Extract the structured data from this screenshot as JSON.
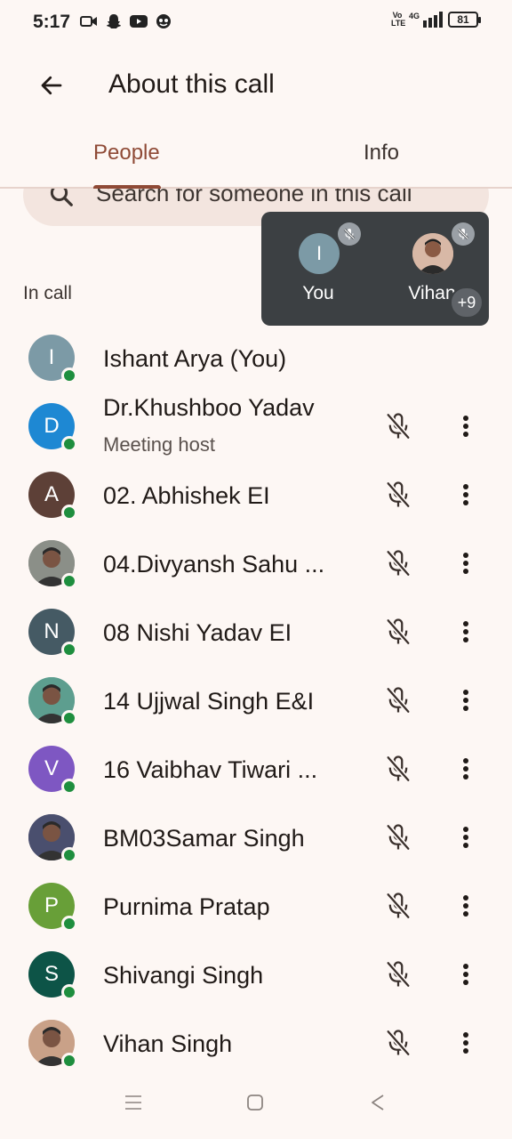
{
  "status_bar": {
    "time": "5:17",
    "left_icons": [
      "video-icon",
      "snapchat-icon",
      "youtube-icon",
      "app-icon"
    ],
    "volte": "Vo LTE",
    "network": "4G",
    "battery": "81"
  },
  "header": {
    "title": "About this call"
  },
  "tabs": [
    {
      "label": "People",
      "active": true
    },
    {
      "label": "Info",
      "active": false
    }
  ],
  "search": {
    "placeholder": "Search for someone in this call"
  },
  "section": {
    "label": "In call"
  },
  "overlay": {
    "tiles": [
      {
        "initial": "I",
        "name": "You"
      },
      {
        "initial": "",
        "name": "Vihan"
      }
    ],
    "more": "+9"
  },
  "participants": [
    {
      "name": "Ishant Arya (You)",
      "subtitle": "",
      "initial": "I",
      "color": "#7c9aa6",
      "photo": false
    },
    {
      "name": "Dr.Khushboo Yadav",
      "subtitle": "Meeting host",
      "initial": "D",
      "color": "#1e88d3",
      "photo": false
    },
    {
      "name": "02. Abhishek EI",
      "subtitle": "",
      "initial": "A",
      "color": "#5d4037",
      "photo": false
    },
    {
      "name": "04.Divyansh Sahu ...",
      "subtitle": "",
      "initial": "",
      "color": "#8b8f88",
      "photo": true
    },
    {
      "name": "08 Nishi Yadav EI",
      "subtitle": "",
      "initial": "N",
      "color": "#455a64",
      "photo": false
    },
    {
      "name": "14 Ujjwal Singh E&I",
      "subtitle": "",
      "initial": "",
      "color": "#5d9e8f",
      "photo": true
    },
    {
      "name": "16 Vaibhav Tiwari ...",
      "subtitle": "",
      "initial": "V",
      "color": "#7e57c2",
      "photo": false
    },
    {
      "name": "BM03Samar Singh",
      "subtitle": "",
      "initial": "",
      "color": "#4a4f6e",
      "photo": true
    },
    {
      "name": "Purnima Pratap",
      "subtitle": "",
      "initial": "P",
      "color": "#689f38",
      "photo": false
    },
    {
      "name": "Shivangi Singh",
      "subtitle": "",
      "initial": "S",
      "color": "#0d5447",
      "photo": false
    },
    {
      "name": "Vihan Singh",
      "subtitle": "",
      "initial": "",
      "color": "#c9a188",
      "photo": true
    }
  ],
  "navbar": {
    "icons": [
      "recents-icon",
      "home-icon",
      "back-nav-icon"
    ]
  }
}
